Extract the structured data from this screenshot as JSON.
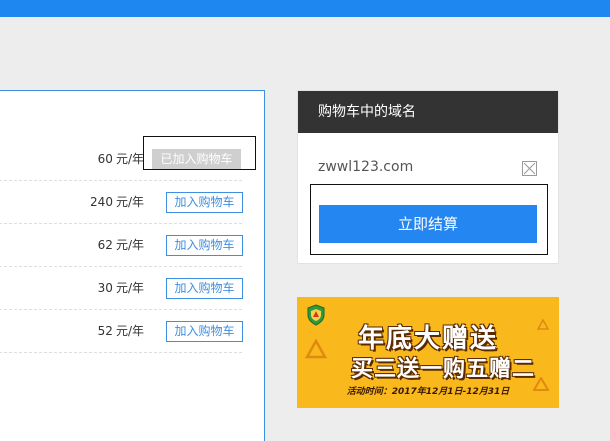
{
  "domain_list": {
    "rows": [
      {
        "price": "60",
        "unit": "元/年",
        "button": "已加入购物车",
        "added": true
      },
      {
        "price": "240",
        "unit": "元/年",
        "button": "加入购物车",
        "added": false
      },
      {
        "price": "62",
        "unit": "元/年",
        "button": "加入购物车",
        "added": false
      },
      {
        "price": "30",
        "unit": "元/年",
        "button": "加入购物车",
        "added": false
      },
      {
        "price": "52",
        "unit": "元/年",
        "button": "加入购物车",
        "added": false
      }
    ]
  },
  "cart": {
    "title": "购物车中的域名",
    "items": [
      {
        "domain": "zwwl123.com"
      }
    ],
    "checkout_label": "立即结算"
  },
  "banner": {
    "line1": "年底大赠送",
    "line2": "买三送一购五赠二",
    "date_text": "活动时间：2017年12月1日-12月31日"
  },
  "colors": {
    "accent": "#2486f0",
    "top_bar": "#1e88f0",
    "banner_bg": "#f9b81c"
  }
}
